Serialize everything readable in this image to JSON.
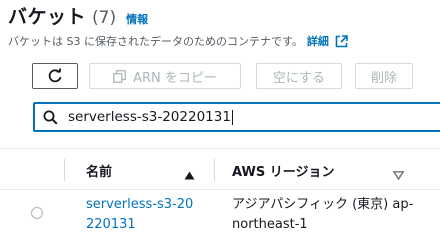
{
  "header": {
    "title": "バケット",
    "count": "(7)",
    "info_link": "情報"
  },
  "description": {
    "text": "バケットは S3 に保存されたデータのためのコンテナです。",
    "detail_link": "詳細"
  },
  "toolbar": {
    "refresh_icon": "refresh-icon",
    "copy_arn_label": "ARN をコピー",
    "empty_label": "空にする",
    "delete_label": "削除"
  },
  "search": {
    "value": "serverless-s3-20220131"
  },
  "table": {
    "columns": [
      {
        "label": "名前",
        "sort": "ascending"
      },
      {
        "label": "AWS リージョン",
        "sort": "none"
      }
    ],
    "rows": [
      {
        "name": "serverless-s3-20220131",
        "region": "アジアパシフィック (東京) ap-northeast-1"
      }
    ]
  },
  "colors": {
    "link": "#0073bb",
    "text": "#16191f",
    "disabled": "#aab7b8"
  }
}
